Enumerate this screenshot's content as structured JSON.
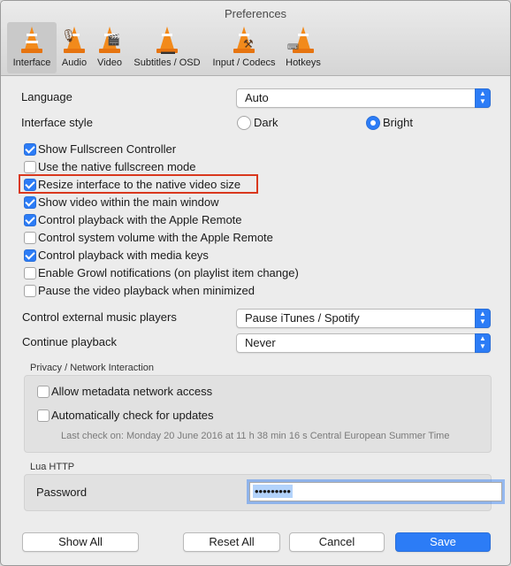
{
  "window": {
    "title": "Preferences"
  },
  "tabs": [
    {
      "label": "Interface",
      "icon": "vlc-cone-interface-icon"
    },
    {
      "label": "Audio",
      "icon": "vlc-cone-audio-icon"
    },
    {
      "label": "Video",
      "icon": "vlc-cone-video-icon"
    },
    {
      "label": "Subtitles / OSD",
      "icon": "vlc-cone-subtitles-icon"
    },
    {
      "label": "Input / Codecs",
      "icon": "vlc-cone-input-icon"
    },
    {
      "label": "Hotkeys",
      "icon": "vlc-cone-hotkeys-icon"
    }
  ],
  "language": {
    "label": "Language",
    "value": "Auto"
  },
  "interface_style": {
    "label": "Interface style",
    "options": [
      "Dark",
      "Bright"
    ],
    "selected": "Bright"
  },
  "checkboxes": [
    {
      "label": "Show Fullscreen Controller",
      "checked": true
    },
    {
      "label": "Use the native fullscreen mode",
      "checked": false
    },
    {
      "label": "Resize interface to the native video size",
      "checked": true
    },
    {
      "label": "Show video within the main window",
      "checked": true
    },
    {
      "label": "Control playback with the Apple Remote",
      "checked": true
    },
    {
      "label": "Control system volume with the Apple Remote",
      "checked": false
    },
    {
      "label": "Control playback with media keys",
      "checked": true
    },
    {
      "label": "Enable Growl notifications (on playlist item change)",
      "checked": false
    },
    {
      "label": "Pause the video playback when minimized",
      "checked": false
    }
  ],
  "external_players": {
    "label": "Control external music players",
    "value": "Pause iTunes / Spotify"
  },
  "continue_playback": {
    "label": "Continue playback",
    "value": "Never"
  },
  "privacy": {
    "title": "Privacy / Network Interaction",
    "metadata_label": "Allow metadata network access",
    "updates_label": "Automatically check for updates",
    "last_check": "Last check on: Monday 20 June 2016 at 11 h 38 min 16 s Central European Summer Time"
  },
  "lua": {
    "title": "Lua HTTP",
    "password_label": "Password",
    "password_value": "•••••••••"
  },
  "buttons": {
    "show_all": "Show All",
    "reset_all": "Reset All",
    "cancel": "Cancel",
    "save": "Save"
  },
  "colors": {
    "accent": "#2c7cf6",
    "highlight_border": "#d9381e",
    "cone": "#f28a1b"
  }
}
